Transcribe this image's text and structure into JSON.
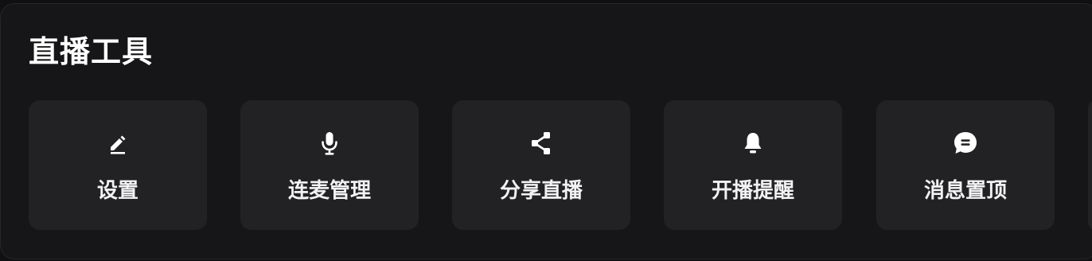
{
  "panel": {
    "title": "直播工具",
    "tools": [
      {
        "label": "设置",
        "icon": "edit-icon"
      },
      {
        "label": "连麦管理",
        "icon": "microphone-icon"
      },
      {
        "label": "分享直播",
        "icon": "share-icon"
      },
      {
        "label": "开播提醒",
        "icon": "bell-icon"
      },
      {
        "label": "消息置顶",
        "icon": "chat-bubble-icon"
      }
    ]
  },
  "colors": {
    "background": "#161618",
    "tile": "#222225",
    "text": "#ffffff"
  }
}
